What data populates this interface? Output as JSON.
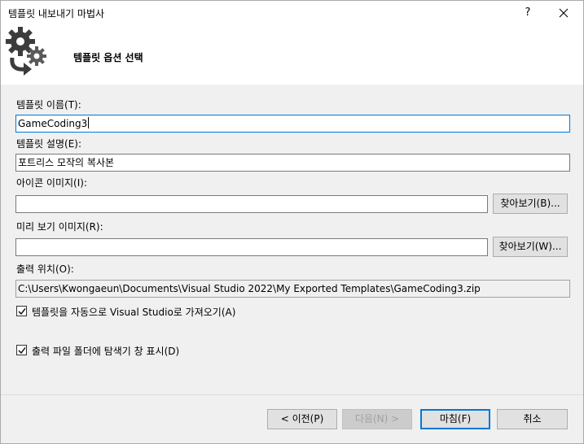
{
  "window": {
    "title": "템플릿 내보내기 마법사",
    "help_label": "?"
  },
  "header": {
    "title": "템플릿 옵션 선택",
    "icon": "gears-arrow-icon"
  },
  "form": {
    "name_label": "템플릿 이름(T):",
    "name_value": "GameCoding3",
    "description_label": "템플릿 설명(E):",
    "description_value": "포트리스 모작의 복사본",
    "icon_image_label": "아이콘 이미지(I):",
    "icon_image_value": "",
    "icon_browse_label": "찾아보기(B)...",
    "preview_image_label": "미리 보기 이미지(R):",
    "preview_image_value": "",
    "preview_browse_label": "찾아보기(W)...",
    "output_label": "출력 위치(O):",
    "output_value": "C:\\Users\\Kwongaeun\\Documents\\Visual Studio 2022\\My Exported Templates\\GameCoding3.zip",
    "auto_import_label": "템플릿을 자동으로 Visual Studio로 가져오기(A)",
    "auto_import_checked": true,
    "show_folder_label": "출력 파일 폴더에 탐색기 창 표시(D)",
    "show_folder_checked": true
  },
  "footer": {
    "prev_label": "< 이전(P)",
    "next_label": "다음(N) >",
    "finish_label": "마침(F)",
    "cancel_label": "취소"
  },
  "colors": {
    "accent": "#0078d7",
    "window_bg": "#f0f0f0",
    "header_bg": "#ffffff",
    "button_bg": "#e1e1e1"
  }
}
